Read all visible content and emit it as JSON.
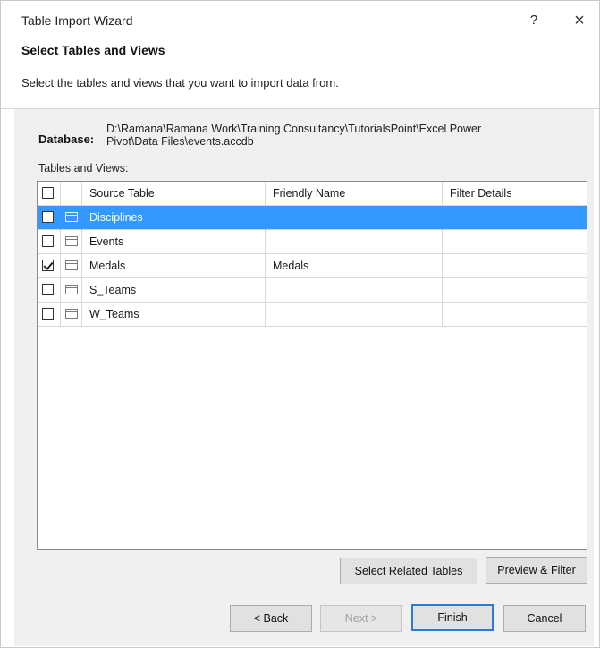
{
  "window": {
    "title": "Table Import Wizard",
    "help_label": "?",
    "close_label": "×"
  },
  "header": {
    "step_title": "Select Tables and Views",
    "step_description": "Select the tables and views that you want to import data from."
  },
  "database": {
    "label": "Database:",
    "path_line1": "D:\\Ramana\\Ramana Work\\Training  Consultancy\\TutorialsPoint\\Excel Power",
    "path_line2": "Pivot\\Data Files\\events.accdb"
  },
  "tables_label": "Tables and Views:",
  "grid": {
    "headers": {
      "source": "Source Table",
      "friendly": "Friendly Name",
      "filter": "Filter Details"
    },
    "select_all_checked": false,
    "rows": [
      {
        "source": "Disciplines",
        "friendly": "",
        "filter": "",
        "checked": false,
        "selected": true
      },
      {
        "source": "Events",
        "friendly": "",
        "filter": "",
        "checked": false,
        "selected": false
      },
      {
        "source": "Medals",
        "friendly": "Medals",
        "filter": "",
        "checked": true,
        "selected": false
      },
      {
        "source": "S_Teams",
        "friendly": "",
        "filter": "",
        "checked": false,
        "selected": false
      },
      {
        "source": "W_Teams",
        "friendly": "",
        "filter": "",
        "checked": false,
        "selected": false
      }
    ]
  },
  "actions": {
    "select_related": "Select Related Tables",
    "preview_filter": "Preview & Filter"
  },
  "footer": {
    "back": "< Back",
    "next": "Next >",
    "finish": "Finish",
    "cancel": "Cancel"
  },
  "colors": {
    "selection": "#3399ff",
    "default_button_border": "#2b7bd6"
  }
}
